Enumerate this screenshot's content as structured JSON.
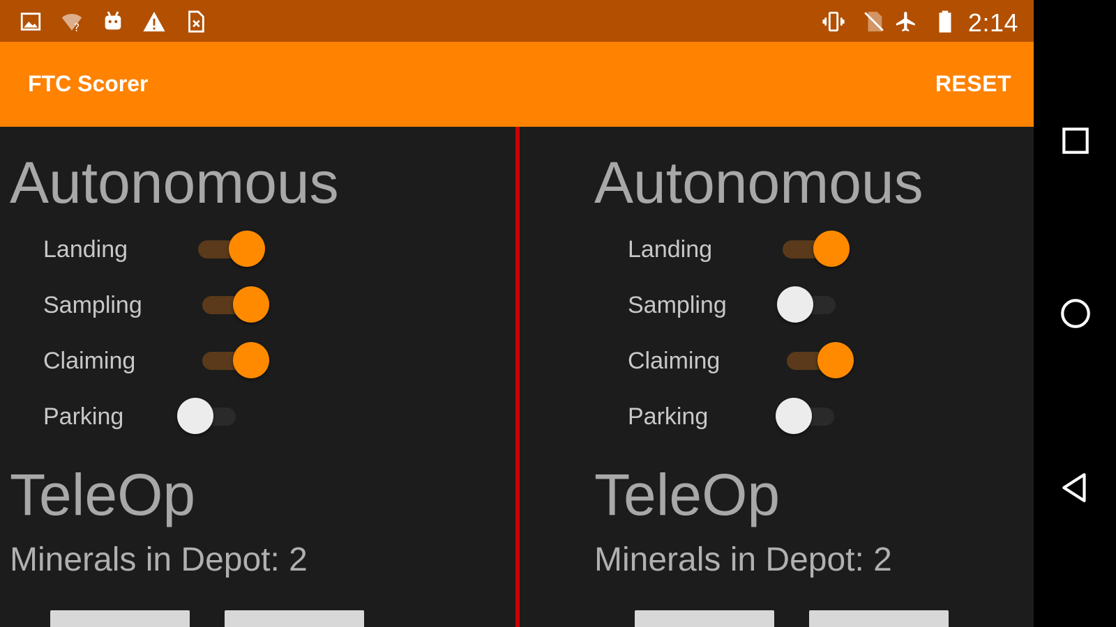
{
  "status_bar": {
    "time": "2:14",
    "left_icons": [
      "image-icon",
      "wifi-question-icon",
      "android-icon",
      "warning-icon",
      "sim-error-icon"
    ],
    "right_icons": [
      "vibrate-icon",
      "no-sim-icon",
      "airplane-icon",
      "battery-icon"
    ]
  },
  "app_bar": {
    "title": "FTC Scorer",
    "action_label": "RESET"
  },
  "colors": {
    "status_bar": "#b34f00",
    "app_bar": "#ff8200",
    "background": "#1c1c1c",
    "divider": "#cc0000",
    "accent": "#ff8a00"
  },
  "panels": [
    {
      "autonomous_title": "Autonomous",
      "toggles": [
        {
          "label": "Landing",
          "on": true
        },
        {
          "label": "Sampling",
          "on": true
        },
        {
          "label": "Claiming",
          "on": true
        },
        {
          "label": "Parking",
          "on": false
        }
      ],
      "teleop_title": "TeleOp",
      "minerals_text": "Minerals in Depot: 2"
    },
    {
      "autonomous_title": "Autonomous",
      "toggles": [
        {
          "label": "Landing",
          "on": true
        },
        {
          "label": "Sampling",
          "on": false
        },
        {
          "label": "Claiming",
          "on": true
        },
        {
          "label": "Parking",
          "on": false
        }
      ],
      "teleop_title": "TeleOp",
      "minerals_text": "Minerals in Depot: 2"
    }
  ],
  "nav_bar": {
    "buttons": [
      "recents-icon",
      "home-icon",
      "back-icon"
    ]
  }
}
